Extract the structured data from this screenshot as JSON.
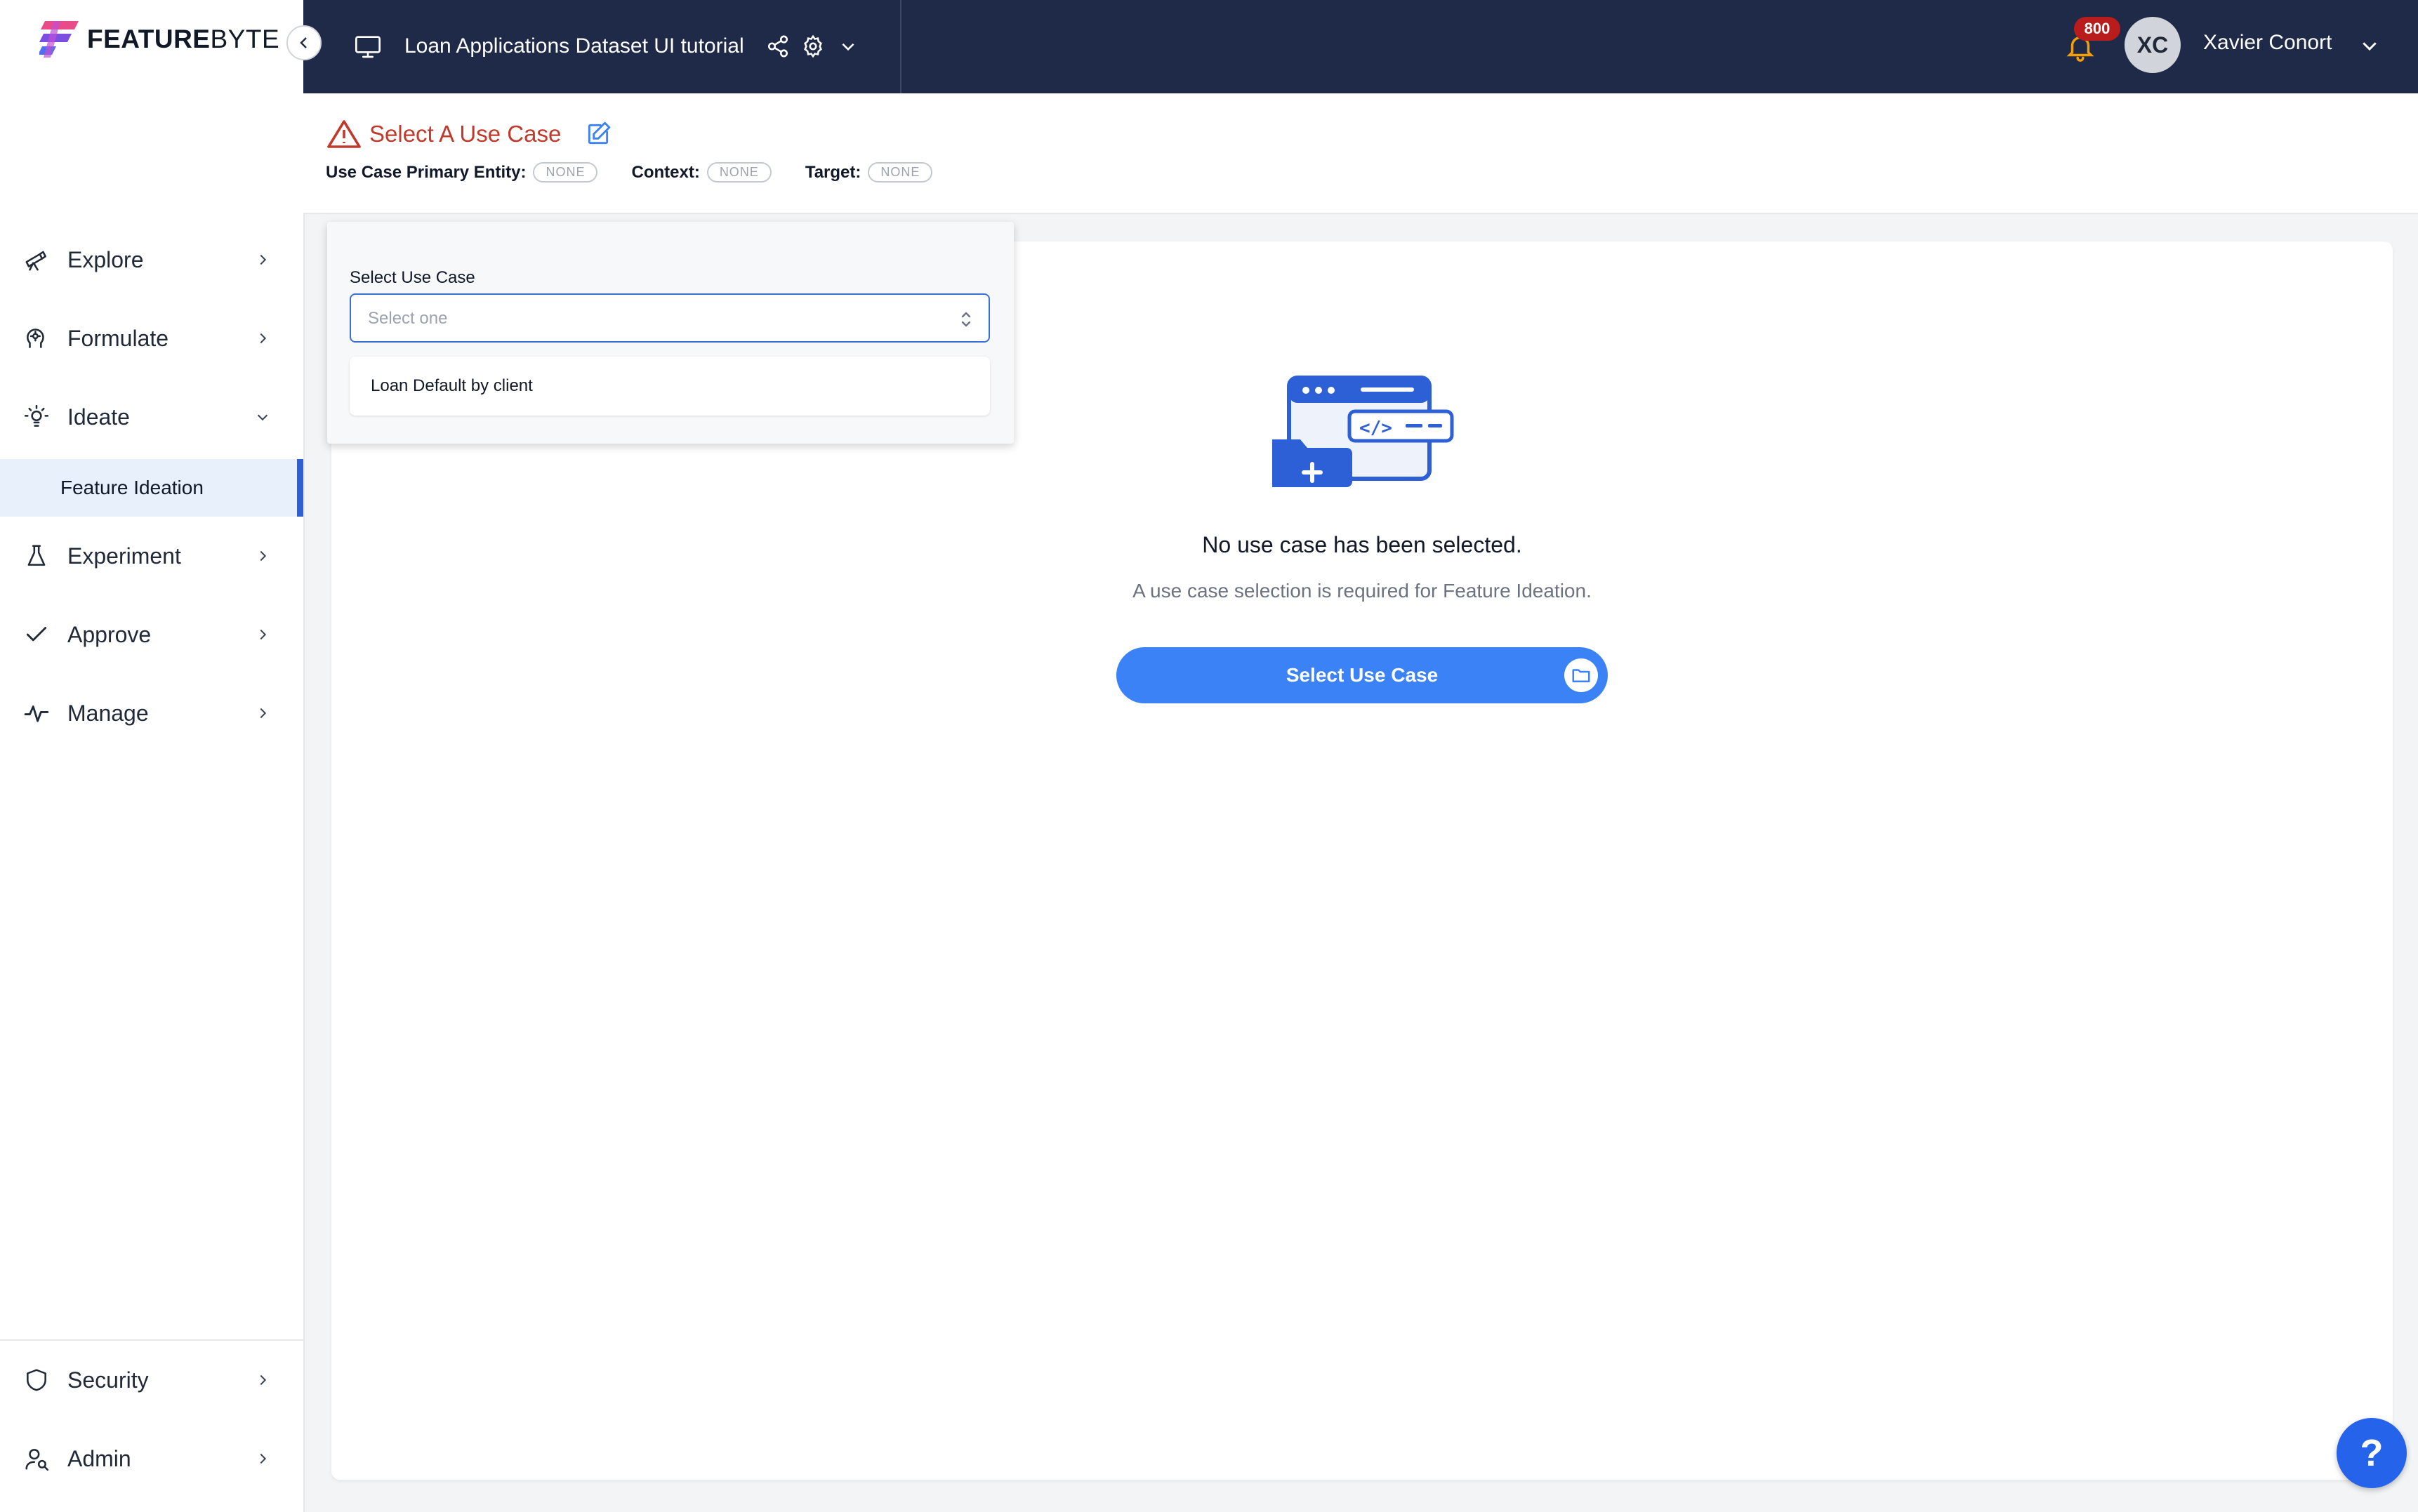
{
  "brand": {
    "bold": "FEATURE",
    "light": "BYTE"
  },
  "sidebar": {
    "items": [
      {
        "label": "Explore",
        "icon": "telescope-icon"
      },
      {
        "label": "Formulate",
        "icon": "head-icon"
      },
      {
        "label": "Ideate",
        "icon": "lightbulb-icon",
        "expanded": true
      },
      {
        "label": "Experiment",
        "icon": "flask-icon"
      },
      {
        "label": "Approve",
        "icon": "check-icon"
      },
      {
        "label": "Manage",
        "icon": "pulse-icon"
      }
    ],
    "sub_item": "Feature Ideation",
    "bottom_items": [
      {
        "label": "Security",
        "icon": "shield-icon"
      },
      {
        "label": "Admin",
        "icon": "user-search-icon"
      }
    ]
  },
  "topbar": {
    "project_title": "Loan Applications Dataset UI tutorial",
    "notification_count": "800",
    "avatar_initials": "XC",
    "user_name": "Xavier Conort"
  },
  "header": {
    "title": "Select A Use Case",
    "primary_entity_label": "Use Case Primary Entity:",
    "primary_entity_value": "NONE",
    "context_label": "Context:",
    "context_value": "NONE",
    "target_label": "Target:",
    "target_value": "NONE"
  },
  "dropdown": {
    "label": "Select Use Case",
    "placeholder": "Select one",
    "options": [
      "Loan Default by client"
    ]
  },
  "empty_state": {
    "title": "No use case has been selected.",
    "subtitle": "A use case selection is required for Feature Ideation.",
    "button_label": "Select Use Case"
  },
  "help": {
    "label": "?"
  },
  "colors": {
    "topbar": "#1e2a47",
    "accent": "#3b82f6",
    "warning_red": "#c0392b",
    "active_bg": "#e8f0fb"
  }
}
